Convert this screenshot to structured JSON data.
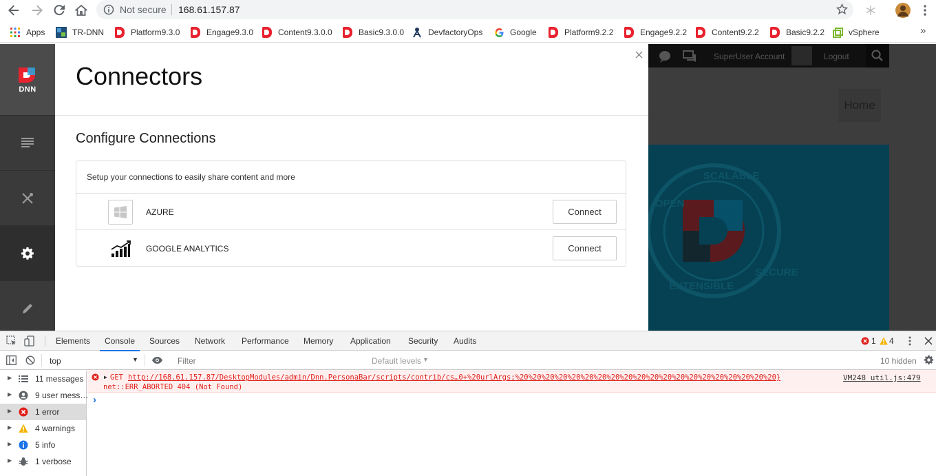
{
  "browser": {
    "security_label": "Not secure",
    "url": "168.61.157.87",
    "bookmarks": [
      {
        "label": "Apps",
        "icon": "apps-grid-icon"
      },
      {
        "label": "TR-DNN",
        "icon": "tr-dnn-icon"
      },
      {
        "label": "Platform9.3.0",
        "icon": "dnn-icon"
      },
      {
        "label": "Engage9.3.0",
        "icon": "dnn-icon"
      },
      {
        "label": "Content9.3.0.0",
        "icon": "dnn-icon"
      },
      {
        "label": "Basic9.3.0.0",
        "icon": "dnn-icon"
      },
      {
        "label": "DevfactoryOps",
        "icon": "devfactory-icon"
      },
      {
        "label": "Google",
        "icon": "google-icon"
      },
      {
        "label": "Platform9.2.2",
        "icon": "dnn-icon"
      },
      {
        "label": "Engage9.2.2",
        "icon": "dnn-icon"
      },
      {
        "label": "Content9.2.2",
        "icon": "dnn-icon"
      },
      {
        "label": "Basic9.2.2",
        "icon": "dnn-icon"
      },
      {
        "label": "vSphere",
        "icon": "vsphere-icon"
      }
    ],
    "more_label": "»"
  },
  "personabar": {
    "logo_text": "DNN"
  },
  "panel": {
    "title": "Connectors",
    "subtitle": "Configure Connections",
    "intro": "Setup your connections to easily share content and more",
    "connectors": [
      {
        "name": "AZURE",
        "button": "Connect",
        "icon": "windows-icon"
      },
      {
        "name": "GOOGLE ANALYTICS",
        "button": "Connect",
        "icon": "analytics-chart-icon"
      }
    ]
  },
  "site": {
    "account": "SuperUser Account",
    "logout": "Logout",
    "home": "Home",
    "badge_words": [
      "OPEN",
      "SCALABLE",
      "SECURE",
      "EXTENSIBLE"
    ]
  },
  "devtools": {
    "tabs": [
      "Elements",
      "Console",
      "Sources",
      "Network",
      "Performance",
      "Memory",
      "Application",
      "Security",
      "Audits"
    ],
    "active_tab": "Console",
    "error_count": "1",
    "warning_count": "4",
    "context": "top",
    "filter_placeholder": "Filter",
    "levels": "Default levels",
    "hidden": "10 hidden",
    "sidebar": [
      {
        "label": "11 messages",
        "icon": "list-icon"
      },
      {
        "label": "9 user mess…",
        "icon": "user-icon"
      },
      {
        "label": "1 error",
        "icon": "error-icon"
      },
      {
        "label": "4 warnings",
        "icon": "warning-icon"
      },
      {
        "label": "5 info",
        "icon": "info-icon"
      },
      {
        "label": "1 verbose",
        "icon": "bug-icon"
      }
    ],
    "error": {
      "method": "GET",
      "url": "http://168.61.157.87/DesktopModules/admin/Dnn.PersonaBar/scripts/contrib/cs…0+%20urlArgs;%20%20%20%20%20%20%20%20%20%20%20%20%20%20%20%20%20%20%20%20}",
      "status": "net::ERR_ABORTED 404 (Not Found)",
      "source": "VM248 util.js:479"
    },
    "prompt": "›"
  }
}
